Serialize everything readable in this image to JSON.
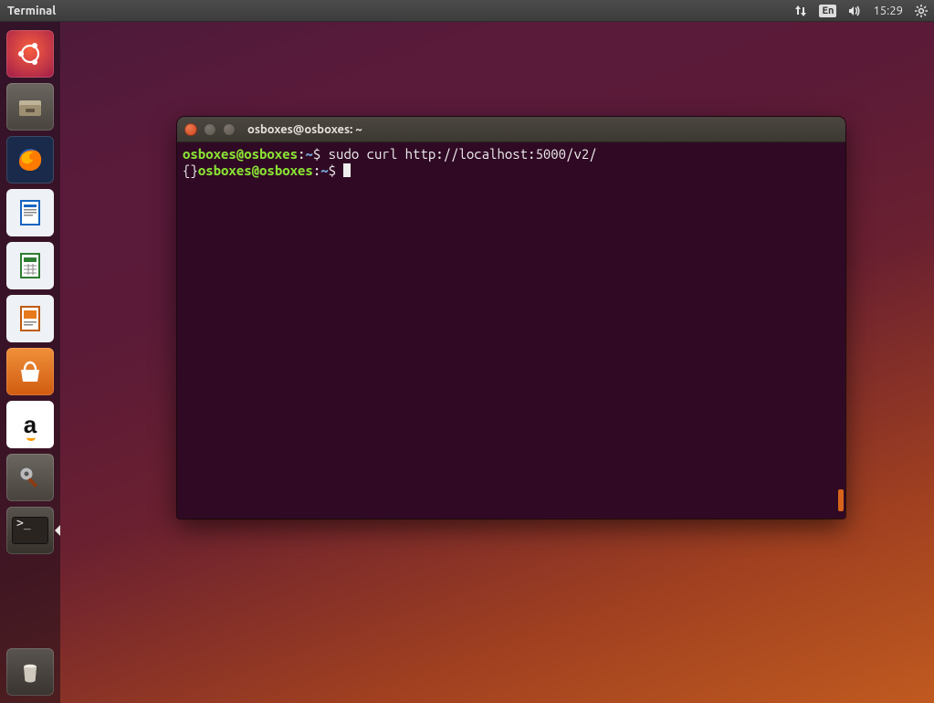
{
  "top_panel": {
    "app_title": "Terminal",
    "language_indicator": "En",
    "clock": "15:29"
  },
  "launcher": {
    "items": [
      {
        "name": "dash-home-icon"
      },
      {
        "name": "files-icon"
      },
      {
        "name": "firefox-icon"
      },
      {
        "name": "writer-icon"
      },
      {
        "name": "calc-icon"
      },
      {
        "name": "impress-icon"
      },
      {
        "name": "ubuntu-software-icon"
      },
      {
        "name": "amazon-icon"
      },
      {
        "name": "system-settings-icon"
      },
      {
        "name": "terminal-icon",
        "running": true
      },
      {
        "name": "trash-icon"
      }
    ]
  },
  "terminal_window": {
    "title": "osboxes@osboxes: ~",
    "prompt": {
      "user_host": "osboxes@osboxes",
      "colon": ":",
      "path": "~",
      "symbol": "$"
    },
    "lines": [
      {
        "kind": "cmd",
        "command": "sudo curl http://localhost:5000/v2/"
      },
      {
        "kind": "output-prompt",
        "output": "{}"
      }
    ],
    "cursor_visible": true
  },
  "icons": {
    "network": "network-up-down-icon",
    "language": "keyboard-language-icon",
    "sound": "volume-high-icon",
    "gear": "system-gear-icon"
  }
}
